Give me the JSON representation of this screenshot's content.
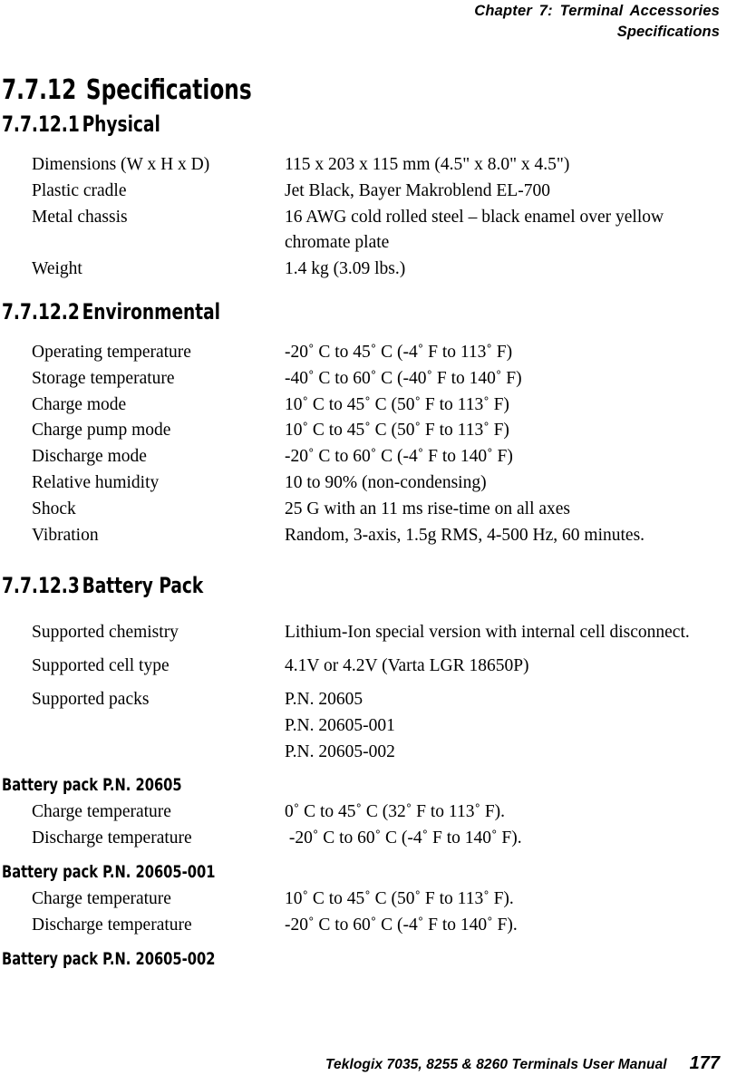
{
  "header": {
    "line1": "Chapter  7:  Terminal Accessories",
    "line2": "Specifications"
  },
  "footer": {
    "manual_title": "Teklogix 7035, 8255 & 8260 Terminals User Manual",
    "page_number": "177"
  },
  "sections": {
    "specifications": {
      "number": "7.7.12",
      "title": "Specifications"
    },
    "physical": {
      "number": "7.7.12.1",
      "title": "Physical",
      "rows": [
        {
          "label": "Dimensions (W x H x D)",
          "value": "115 x 203 x 115 mm (4.5\" x 8.0\" x 4.5\")"
        },
        {
          "label": "Plastic cradle",
          "value": "Jet Black, Bayer Makroblend EL-700"
        },
        {
          "label": "Metal chassis",
          "value": "16 AWG cold rolled steel – black enamel over yellow chromate plate"
        },
        {
          "label": "Weight",
          "value": "1.4 kg (3.09 lbs.)"
        }
      ]
    },
    "environmental": {
      "number": "7.7.12.2",
      "title": "Environmental",
      "rows": [
        {
          "label": "Operating temperature",
          "value": "-20˚ C to 45˚ C (-4˚ F to 113˚ F)"
        },
        {
          "label": "Storage temperature",
          "value": "-40˚ C to 60˚ C (-40˚ F to 140˚ F)"
        },
        {
          "label": "Charge mode",
          "value": "10˚ C to 45˚ C (50˚ F to 113˚ F)"
        },
        {
          "label": "Charge pump mode",
          "value": "10˚ C to 45˚ C (50˚ F to 113˚ F)"
        },
        {
          "label": "Discharge mode",
          "value": "-20˚ C to 60˚ C (-4˚ F to 140˚ F)"
        },
        {
          "label": "Relative humidity",
          "value": "10 to 90% (non-condensing)"
        },
        {
          "label": "Shock",
          "value": "25 G with an 11 ms rise-time on all axes"
        },
        {
          "label": "Vibration",
          "value": "Random, 3-axis, 1.5g RMS, 4-500 Hz, 60 minutes."
        }
      ]
    },
    "battery_pack": {
      "number": "7.7.12.3",
      "title": "Battery  Pack",
      "rows": [
        {
          "label": "Supported chemistry",
          "value": "Lithium-Ion special version with internal cell disconnect."
        },
        {
          "label": "Supported cell type",
          "value": "4.1V or 4.2V (Varta LGR 18650P)"
        },
        {
          "label": "Supported packs",
          "value": "P.N. 20605\nP.N. 20605-001\nP.N. 20605-002"
        }
      ],
      "packs": [
        {
          "heading": "Battery  pack  P.N. 20605",
          "rows": [
            {
              "label": "Charge temperature",
              "value": "0˚ C to 45˚ C (32˚ F to 113˚ F)."
            },
            {
              "label": "Discharge temperature",
              "value": " -20˚ C to 60˚ C (-4˚ F to 140˚ F)."
            }
          ]
        },
        {
          "heading": "Battery  pack  P.N. 20605-001",
          "rows": [
            {
              "label": "Charge temperature",
              "value": "10˚ C to 45˚ C (50˚ F to 113˚ F)."
            },
            {
              "label": "Discharge temperature",
              "value": "-20˚ C to 60˚ C (-4˚ F to 140˚ F)."
            }
          ]
        },
        {
          "heading": "Battery  pack  P.N. 20605-002",
          "rows": []
        }
      ]
    }
  }
}
